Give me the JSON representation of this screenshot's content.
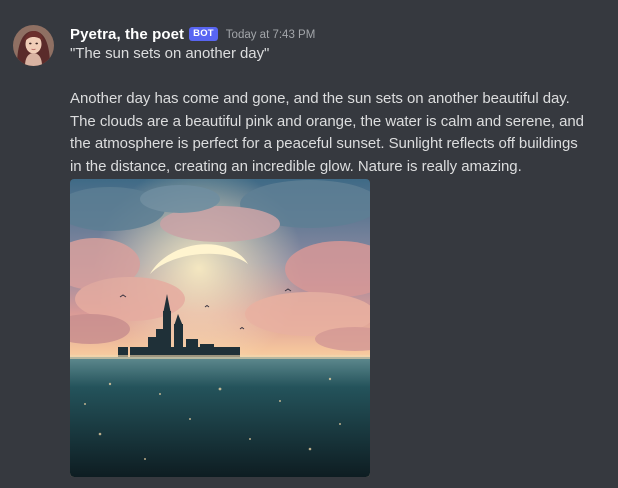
{
  "message": {
    "author": {
      "name": "Pyetra, the poet",
      "badge": "BOT"
    },
    "timestamp": "Today at 7:43 PM",
    "title_line": "\"The sun sets on another day\"",
    "body_lines": [
      "Another day has come and gone, and the sun sets on another beautiful day.",
      "The clouds are a beautiful pink and orange, the water is calm and serene, and",
      "the atmosphere is perfect for a peaceful sunset. Sunlight reflects off buildings",
      "in the distance, creating an incredible glow. Nature is really amazing."
    ],
    "attachment": {
      "kind": "image",
      "subject": "sunset-castle-over-sea"
    }
  },
  "colors": {
    "background": "#36393f",
    "username": "#ffffff",
    "bot_badge": "#5865f2",
    "timestamp": "#a3a6aa",
    "text": "#dcddde"
  }
}
